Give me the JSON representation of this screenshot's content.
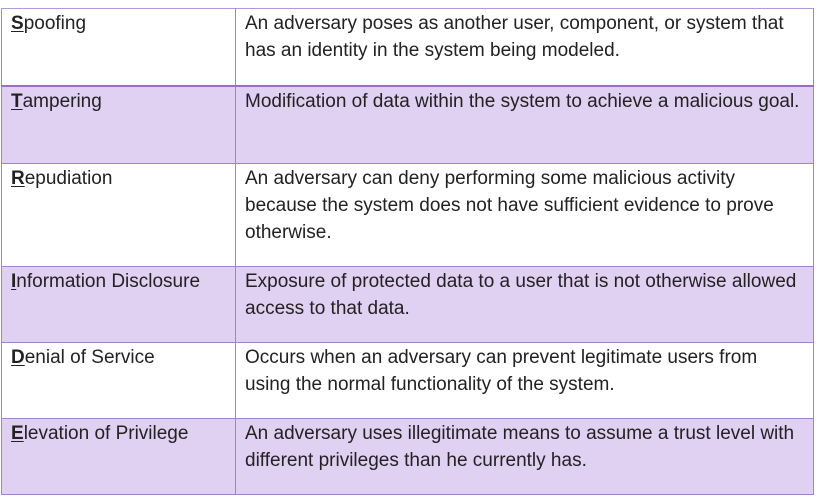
{
  "threats": [
    {
      "letter": "S",
      "rest": "poofing",
      "description": "An adversary poses as another user, component, or system that has an identity in the system being modeled."
    },
    {
      "letter": "T",
      "rest": "ampering",
      "description": "Modification of data within the system to achieve a malicious goal."
    },
    {
      "letter": "R",
      "rest": "epudiation",
      "description": "An adversary can deny performing some malicious activity because the system does not have sufficient evidence to prove otherwise."
    },
    {
      "letter": "I",
      "rest": "nformation Disclosure",
      "description": "Exposure of protected data to a user that is not otherwise allowed access to that data."
    },
    {
      "letter": "D",
      "rest": "enial of Service",
      "description": "Occurs when an adversary can prevent legitimate users from using the normal functionality of the system."
    },
    {
      "letter": "E",
      "rest": "levation of Privilege",
      "description": "An adversary uses illegitimate means to assume a trust level with different privileges than he currently has."
    }
  ],
  "colors": {
    "border": "#a67fcf",
    "row_alt": "#e0d0f2",
    "row": "#ffffff",
    "text": "#222222"
  }
}
